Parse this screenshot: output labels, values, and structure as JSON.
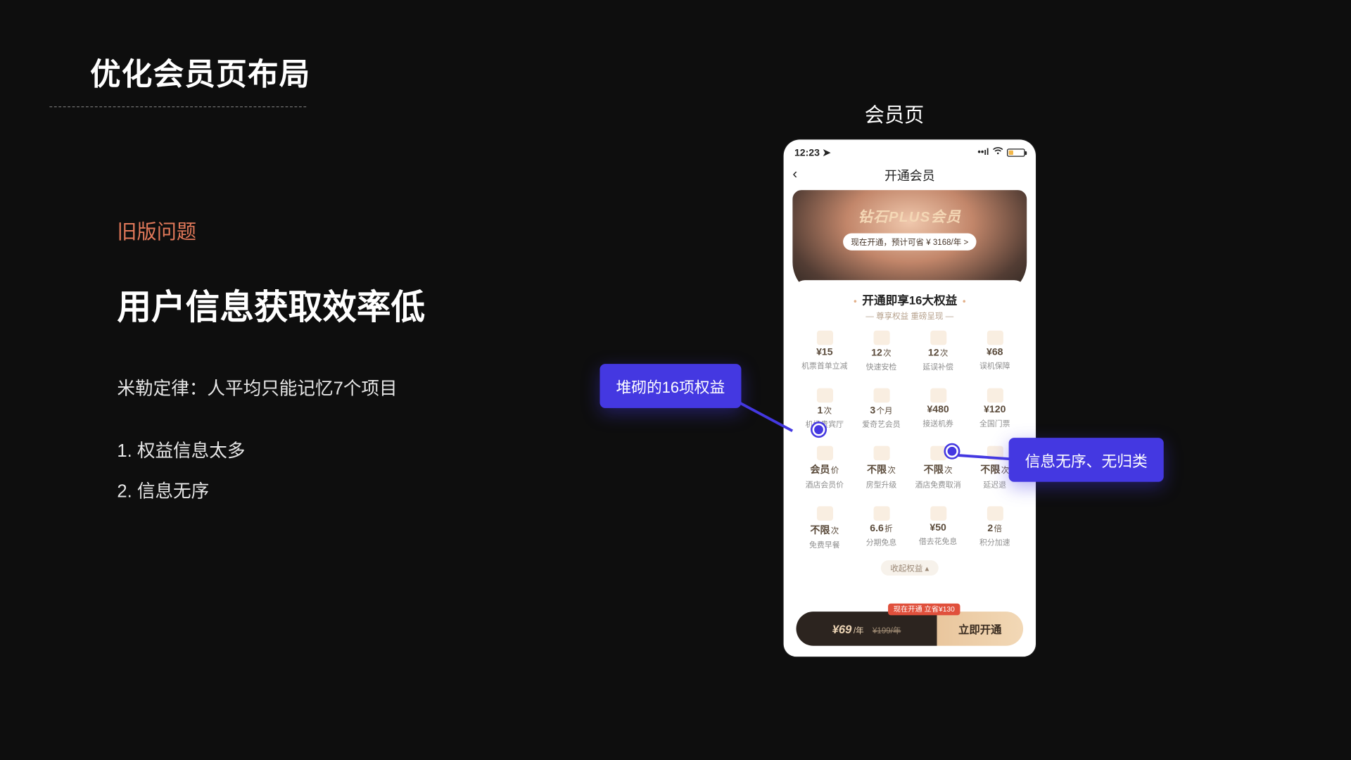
{
  "slide": {
    "title": "优化会员页布局",
    "screenshot_label": "会员页",
    "eyebrow": "旧版问题",
    "headline": "用户信息获取效率低",
    "principle": "米勒定律：人平均只能记忆7个项目",
    "point1": "1. 权益信息太多",
    "point2": "2. 信息无序"
  },
  "phone": {
    "clock": "12:23",
    "nav_title": "开通会员",
    "hero_title": "钻石PLUS会员",
    "hero_pill": "现在开通，预计可省 ¥ 3168/年 >",
    "benefits_title": "开通即享16大权益",
    "benefits_sub": "尊享权益 重磅呈现",
    "collapse": "收起权益 ▴",
    "cta_badge": "现在开通 立省¥130",
    "cta_price_main": "¥69",
    "cta_price_per": "/年",
    "cta_price_old": "¥199/年",
    "cta_button": "立即开通"
  },
  "benefits": [
    {
      "value": "¥15",
      "unit": "",
      "label": "机票首单立减"
    },
    {
      "value": "12",
      "unit": "次",
      "label": "快速安检"
    },
    {
      "value": "12",
      "unit": "次",
      "label": "延误补偿"
    },
    {
      "value": "¥68",
      "unit": "",
      "label": "误机保障"
    },
    {
      "value": "1",
      "unit": "次",
      "label": "机场贵宾厅"
    },
    {
      "value": "3",
      "unit": "个月",
      "label": "爱奇艺会员"
    },
    {
      "value": "¥480",
      "unit": "",
      "label": "接送机券"
    },
    {
      "value": "¥120",
      "unit": "",
      "label": "全国门票"
    },
    {
      "value": "会员",
      "unit": "价",
      "label": "酒店会员价"
    },
    {
      "value": "不限",
      "unit": "次",
      "label": "房型升级"
    },
    {
      "value": "不限",
      "unit": "次",
      "label": "酒店免费取消"
    },
    {
      "value": "不限",
      "unit": "次",
      "label": "延迟退"
    },
    {
      "value": "不限",
      "unit": "次",
      "label": "免费早餐"
    },
    {
      "value": "6.6",
      "unit": "折",
      "label": "分期免息"
    },
    {
      "value": "¥50",
      "unit": "",
      "label": "借去花免息"
    },
    {
      "value": "2",
      "unit": "倍",
      "label": "积分加速"
    }
  ],
  "callouts": {
    "left": "堆砌的16项权益",
    "right": "信息无序、无归类"
  }
}
